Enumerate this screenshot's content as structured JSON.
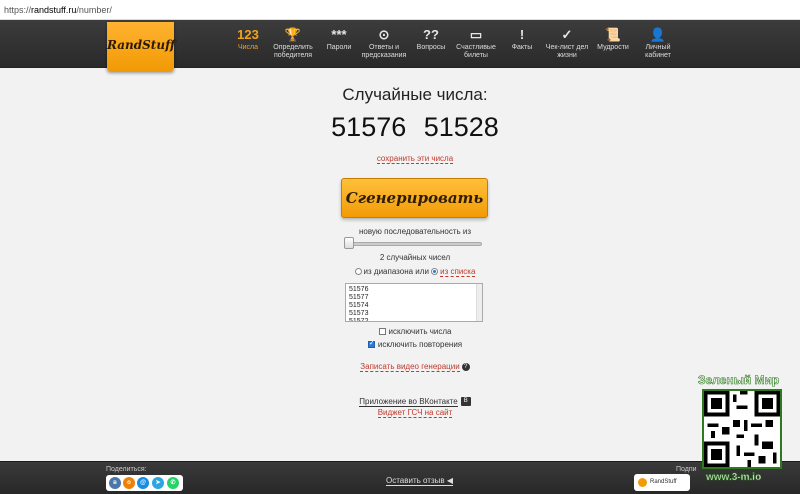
{
  "browser": {
    "url_scheme": "https://",
    "url_host": "randstuff.ru",
    "url_path": "/number/"
  },
  "logo": {
    "text": "RandStuff"
  },
  "nav": [
    {
      "icon": "123",
      "label": "Числа",
      "name": "numbers"
    },
    {
      "icon": "🏆",
      "label": "Определить победителя",
      "name": "winner"
    },
    {
      "icon": "***",
      "label": "Пароли",
      "name": "passwords"
    },
    {
      "icon": "⊙",
      "label": "Ответы и предсказания",
      "name": "answers"
    },
    {
      "icon": "??",
      "label": "Вопросы",
      "name": "questions"
    },
    {
      "icon": "▭",
      "label": "Счастливые билеты",
      "name": "tickets"
    },
    {
      "icon": "!",
      "label": "Факты",
      "name": "facts"
    },
    {
      "icon": "✓",
      "label": "Чек-лист дел жизни",
      "name": "checklist"
    },
    {
      "icon": "📜",
      "label": "Мудрости",
      "name": "wisdom"
    },
    {
      "icon": "👤",
      "label": "Личный кабинет",
      "name": "account"
    }
  ],
  "main": {
    "title": "Случайные числа:",
    "numbers": "51576   51528",
    "save_link": "сохранить эти числа",
    "generate_button": "Сгенерировать",
    "sequence_label": "новую последовательность из",
    "count_label": "2 случайных чисел",
    "range_option": "из диапазона или",
    "list_option": "из списка",
    "list_values": [
      "51576",
      "51577",
      "51574",
      "51573",
      "51572"
    ],
    "exclude_numbers": "исключить числа",
    "exclude_repeats": "исключить повторения",
    "record_video": "Записать видео генерации",
    "vk_app": "Приложение во ВКонтакте",
    "widget": "Виджет ГСЧ на сайт"
  },
  "footer": {
    "share_label": "Поделиться:",
    "review_link": "Оставить отзыв",
    "subscribe_label": "Подпи",
    "subscribe_brand": "RandStuff"
  },
  "watermark": {
    "title": "Зеленый Мир",
    "url": "www.3-m.io"
  },
  "colors": {
    "accent": "#f29b06",
    "link": "#c0392b",
    "nav_bg": "#2e2e2e"
  }
}
